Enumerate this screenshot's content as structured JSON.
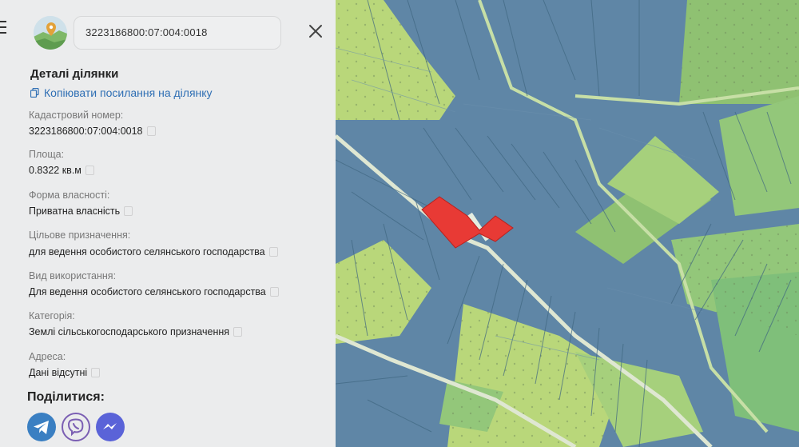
{
  "search": {
    "value": "3223186800:07:004:0018"
  },
  "panel": {
    "title": "Деталі ділянки",
    "copy_link": "Копіювати посилання на ділянку",
    "fields": [
      {
        "label": "Кадастровий номер:",
        "value": "3223186800:07:004:0018"
      },
      {
        "label": "Площа:",
        "value": "0.8322 кв.м"
      },
      {
        "label": "Форма власності:",
        "value": "Приватна власність"
      },
      {
        "label": "Цільове призначення:",
        "value": "для ведення особистого селянського господарства"
      },
      {
        "label": "Вид використання:",
        "value": "Для ведення особистого селянського господарства"
      },
      {
        "label": "Категорія:",
        "value": "Землі сільськогосподарського призначення"
      },
      {
        "label": "Адреса:",
        "value": "Дані відсутні"
      }
    ],
    "share_title": "Поділитися:"
  },
  "share": [
    {
      "name": "telegram",
      "icon": "telegram-icon",
      "color": "#3a7fc2"
    },
    {
      "name": "viber",
      "icon": "viber-icon",
      "color": "#7b5fb3"
    },
    {
      "name": "messenger",
      "icon": "messenger-icon",
      "color": "#5a63d8"
    }
  ],
  "colors": {
    "parcel_blue": "#5f86a6",
    "parcel_green": "#93c77a",
    "parcel_lightgreen": "#b9d77a",
    "parcel_selected": "#e83a35",
    "link": "#2f6fb4"
  }
}
